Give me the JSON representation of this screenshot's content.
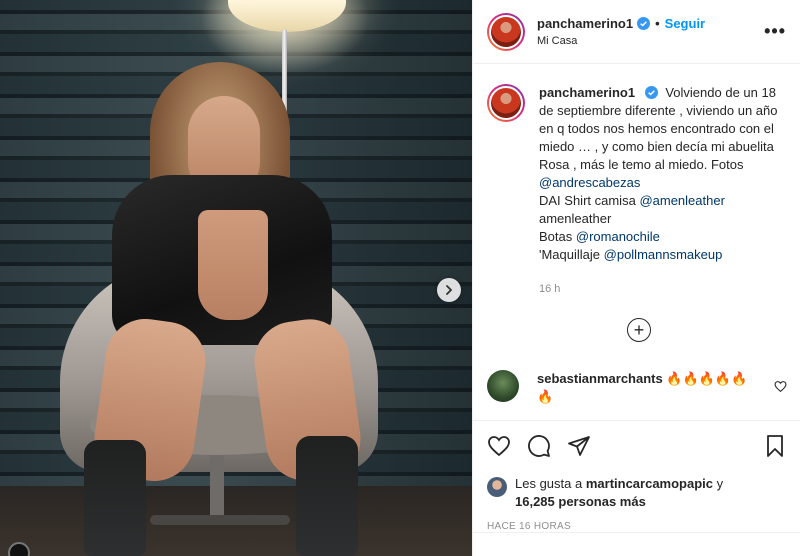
{
  "post": {
    "username": "panchamerino1",
    "follow_label": "Seguir",
    "dot": "•",
    "location": "Mi Casa",
    "more": "•••"
  },
  "caption": {
    "username": "panchamerino1",
    "text_1": "Volviendo de un 18 de septiembre diferente , viviendo un año en q todos nos hemos encontrado con el miedo … , y como bien decía mi abuelita Rosa , más le temo al miedo. Fotos",
    "tag_1": "@andrescabezas",
    "text_2": "DAI Shirt camisa",
    "tag_2": "@amenleather",
    "text_3": "amenleather",
    "text_4": "Botas",
    "tag_3": "@romanochile",
    "text_5": "'Maquillaje",
    "tag_4": "@pollmannsmakeup",
    "time": "16 h"
  },
  "add_comment_symbol": "+",
  "comment": {
    "username": "sebastianmarchants",
    "text": "🔥🔥🔥🔥🔥🔥"
  },
  "likes": {
    "prefix": "Les gusta a",
    "user": "martincarcamopapic",
    "and": "y",
    "count": "16,285 personas más"
  },
  "timeago": "HACE 16 HORAS",
  "icons": [
    "heart-icon",
    "comment-icon",
    "share-icon",
    "bookmark-icon",
    "verified-icon",
    "chevron-right-icon",
    "add-circle-icon"
  ],
  "colors": {
    "accent": "#0095f6",
    "verified": "#3897f0",
    "tag": "#00376b",
    "muted": "#8e8e8e"
  }
}
